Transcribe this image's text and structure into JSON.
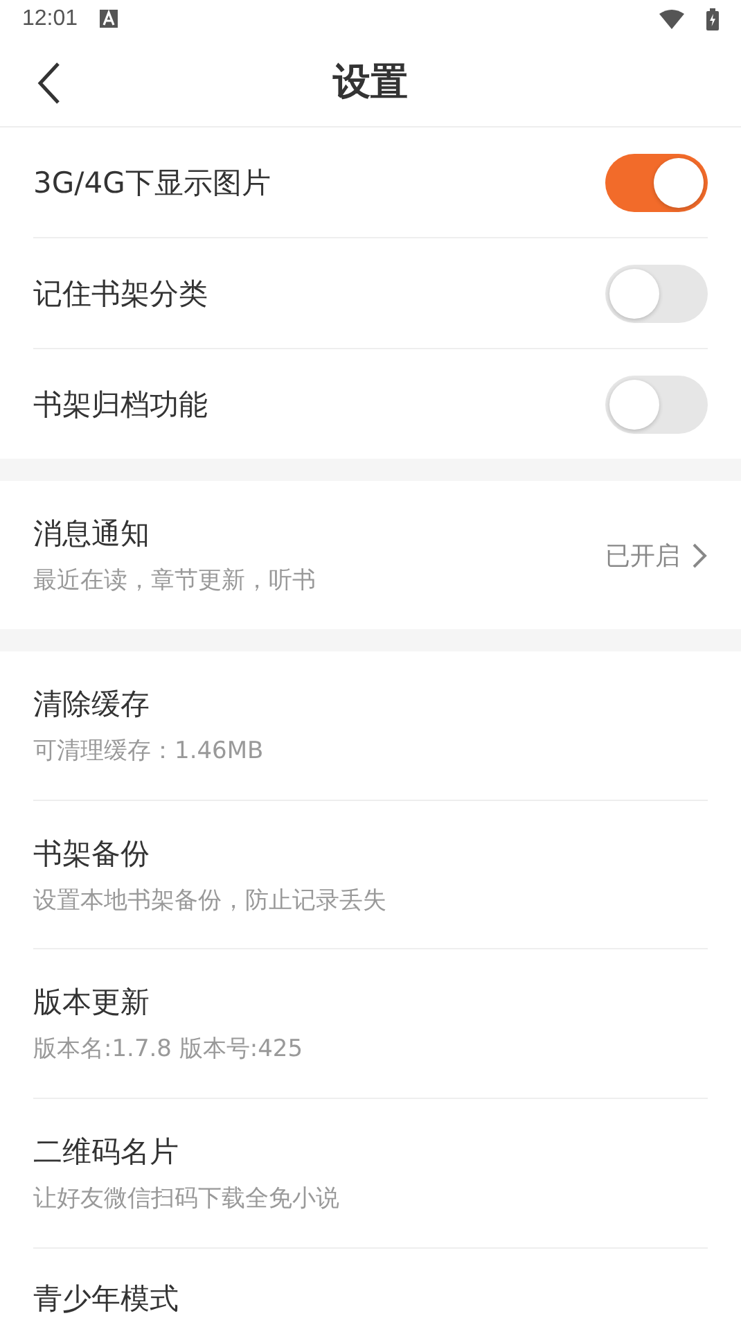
{
  "status_bar": {
    "time": "12:01"
  },
  "header": {
    "title": "设置"
  },
  "toggles": [
    {
      "label": "3G/4G下显示图片",
      "on": true
    },
    {
      "label": "记住书架分类",
      "on": false
    },
    {
      "label": "书架归档功能",
      "on": false
    }
  ],
  "notification": {
    "title": "消息通知",
    "subtitle": "最近在读，章节更新，听书",
    "value": "已开启"
  },
  "items": [
    {
      "title": "清除缓存",
      "subtitle": "可清理缓存：1.46MB"
    },
    {
      "title": "书架备份",
      "subtitle": "设置本地书架备份，防止记录丢失"
    },
    {
      "title": "版本更新",
      "subtitle": "版本名:1.7.8  版本号:425"
    },
    {
      "title": "二维码名片",
      "subtitle": "让好友微信扫码下载全免小说"
    },
    {
      "title": "青少年模式"
    }
  ]
}
